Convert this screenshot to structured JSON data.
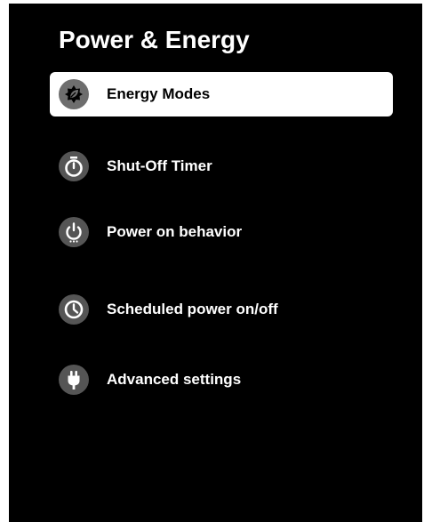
{
  "page": {
    "title": "Power & Energy"
  },
  "menu": {
    "items": [
      {
        "label": "Energy Modes",
        "icon": "energy-leaf-icon",
        "selected": true
      },
      {
        "label": "Shut-Off Timer",
        "icon": "timer-icon",
        "selected": false
      },
      {
        "label": "Power on behavior",
        "icon": "power-icon",
        "selected": false
      },
      {
        "label": "Scheduled power on/off",
        "icon": "clock-icon",
        "selected": false
      },
      {
        "label": "Advanced settings",
        "icon": "plug-icon",
        "selected": false
      }
    ]
  },
  "colors": {
    "background": "#000000",
    "selected_background": "#ffffff",
    "icon_circle": "#555555",
    "text": "#ffffff",
    "selected_text": "#000000"
  }
}
